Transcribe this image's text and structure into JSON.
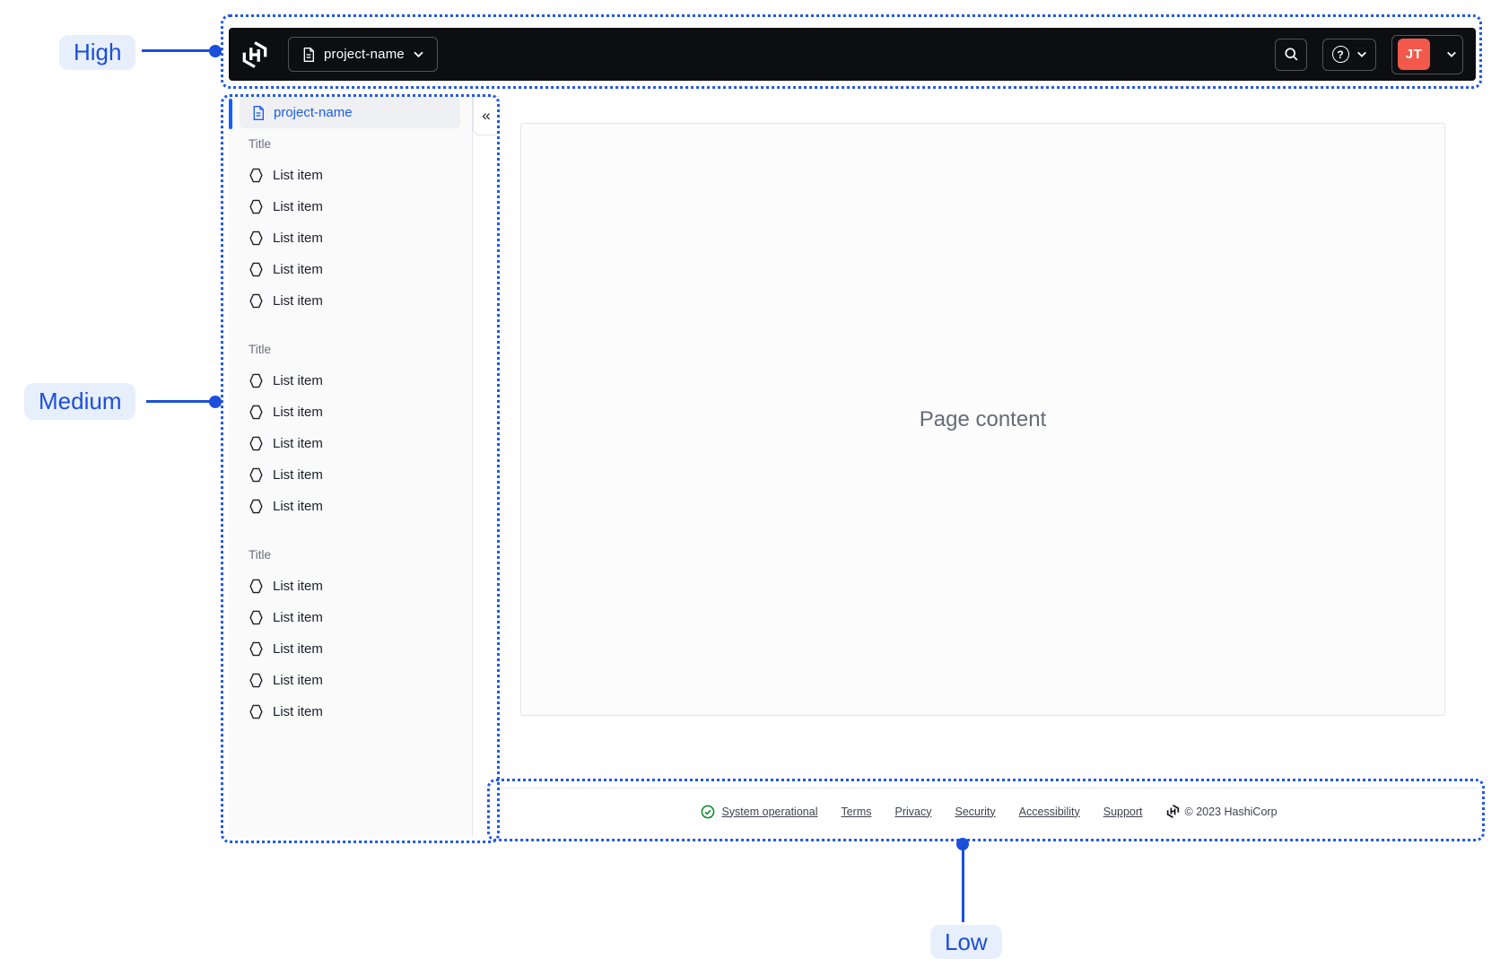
{
  "colors": {
    "annotation_blue": "#1b4fdb",
    "annotation_pill_bg": "#e8effc",
    "navbar_bg": "#0d0e12",
    "accent_blue": "#1060ff",
    "avatar_bg": "#f2594b",
    "status_green": "#008a22"
  },
  "annotations": {
    "high": {
      "label": "High"
    },
    "medium": {
      "label": "Medium"
    },
    "low": {
      "label": "Low"
    }
  },
  "navbar": {
    "project_selector": {
      "label": "project-name"
    },
    "help_glyph": "?",
    "user": {
      "initials": "JT"
    }
  },
  "sidebar": {
    "header": {
      "label": "project-name"
    },
    "collapse_glyph": "«",
    "sections": [
      {
        "title": "Title",
        "items": [
          "List item",
          "List item",
          "List item",
          "List item",
          "List item"
        ]
      },
      {
        "title": "Title",
        "items": [
          "List item",
          "List item",
          "List item",
          "List item",
          "List item"
        ]
      },
      {
        "title": "Title",
        "items": [
          "List item",
          "List item",
          "List item",
          "List item",
          "List item"
        ]
      }
    ]
  },
  "main": {
    "placeholder": "Page content"
  },
  "footer": {
    "status": {
      "label": "System operational"
    },
    "links": [
      "Terms",
      "Privacy",
      "Security",
      "Accessibility",
      "Support"
    ],
    "copyright": "© 2023 HashiCorp"
  }
}
